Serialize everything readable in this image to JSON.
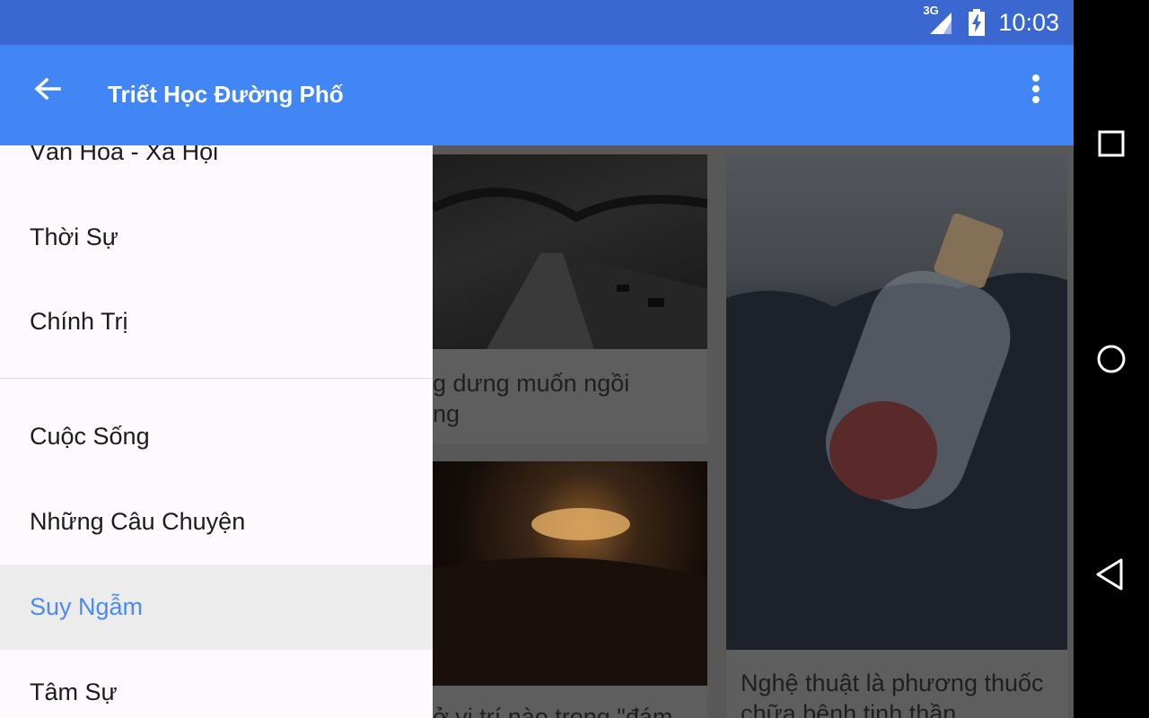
{
  "status": {
    "network": "3G",
    "time": "10:03"
  },
  "toolbar": {
    "title": "Triết Học Đường Phố"
  },
  "drawer": {
    "items": [
      {
        "label": "Văn Hóa - Xã Hội"
      },
      {
        "label": "Thời Sự"
      },
      {
        "label": "Chính Trị"
      },
      {
        "label": "Cuộc Sống"
      },
      {
        "label": "Những Câu Chuyện"
      },
      {
        "label": "Suy Ngẫm",
        "selected": true
      },
      {
        "label": "Tâm Sự"
      }
    ]
  },
  "cards": [
    {
      "title_line1": "g dưng muốn ngồi",
      "title_line2": "ng"
    },
    {
      "title_line1": "ở vị trí nào trong \"đám"
    },
    {
      "title_line1": "Nghệ thuật là phương thuốc",
      "title_line2": "chữa bệnh tinh thần"
    }
  ],
  "colors": {
    "status_bar": "#3a68d0",
    "toolbar": "#4285f4",
    "selected_text": "#4a8af4"
  },
  "icons": [
    "arrow-back-icon",
    "more-vert-icon",
    "recents-icon",
    "home-icon",
    "back-triangle-icon",
    "signal-icon",
    "battery-charging-icon"
  ]
}
